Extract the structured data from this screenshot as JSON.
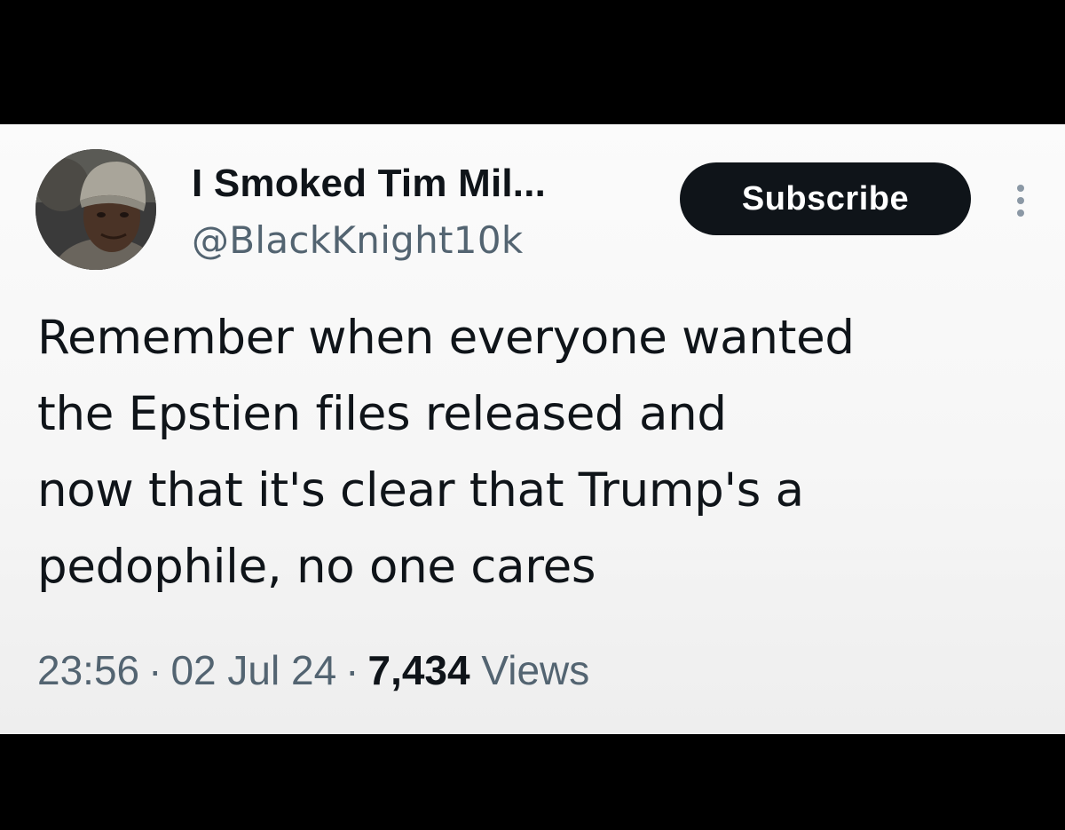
{
  "tweet": {
    "author": {
      "display_name": "I Smoked Tim Mil...",
      "handle": "@BlackKnight10k"
    },
    "subscribe_label": "Subscribe",
    "more_icon": "ellipsis-vertical-icon",
    "text_lines": [
      "Remember when everyone wanted",
      "the Epstien files released and",
      "now that it's clear that Trump's a",
      "pedophile, no one cares"
    ],
    "meta": {
      "time": "23:56",
      "separator": "·",
      "date": "02 Jul 24",
      "views_count": "7,434",
      "views_label": "Views"
    }
  },
  "colors": {
    "background": "#000000",
    "card": "#f8f8f8",
    "primary_text": "#0f1419",
    "secondary_text": "#536471",
    "button": "#0f1419"
  }
}
